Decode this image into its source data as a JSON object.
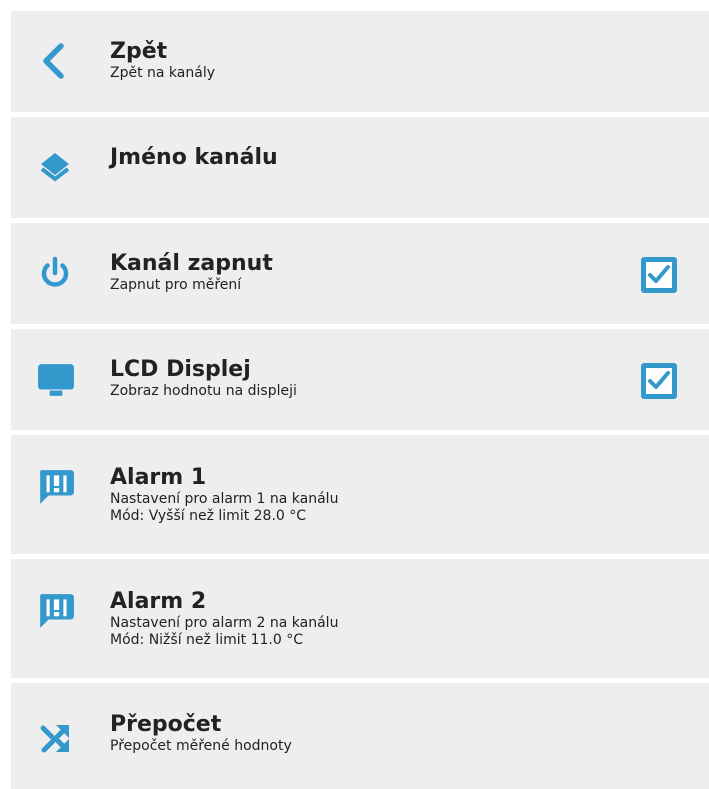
{
  "accent_color": "#3399cc",
  "menu": {
    "items": [
      {
        "icon": "chevron-left-icon",
        "title": "Zpět",
        "subtitle": "Zpět na kanály"
      },
      {
        "icon": "layers-icon",
        "title": "Jméno kanálu"
      },
      {
        "icon": "power-icon",
        "title": "Kanál zapnut",
        "subtitle": "Zapnut pro měření",
        "checked": true
      },
      {
        "icon": "monitor-icon",
        "title": "LCD Displej",
        "subtitle": "Zobraz hodnotu na displeji",
        "checked": true
      },
      {
        "icon": "alarm-message-icon",
        "title": "Alarm 1",
        "subtitle": "Nastavení pro alarm 1 na kanálu",
        "detail": "Mód: Vyšší než limit 28.0 °C"
      },
      {
        "icon": "alarm-message-icon",
        "title": "Alarm 2",
        "subtitle": "Nastavení pro alarm 2 na kanálu",
        "detail": "Mód: Nižší než limit 11.0 °C"
      },
      {
        "icon": "shuffle-icon",
        "title": "Přepočet",
        "subtitle": "Přepočet měřené hodnoty"
      }
    ]
  }
}
